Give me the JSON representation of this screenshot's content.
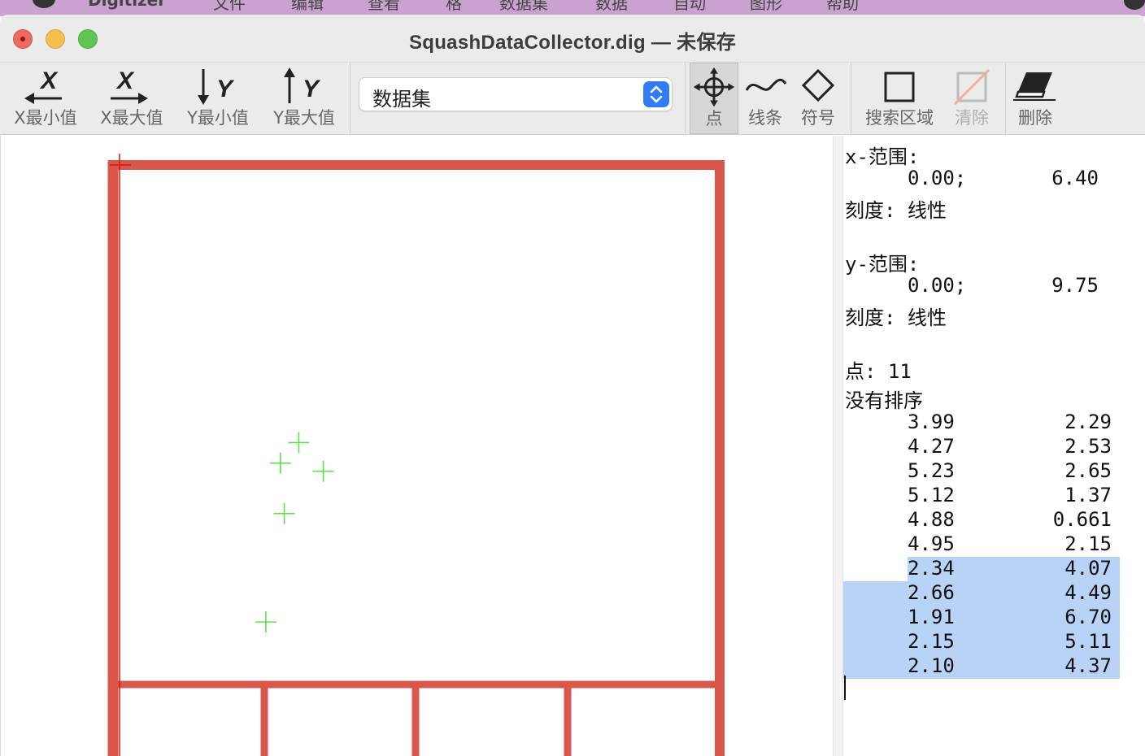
{
  "menubar": {
    "app_name": "Digitizer",
    "items": [
      "文件",
      "编辑",
      "查看",
      "格",
      "数据集",
      "数据",
      "自动",
      "图形",
      "帮助"
    ]
  },
  "window": {
    "title": "SquashDataCollector.dig — 未保存"
  },
  "toolbar": {
    "x_min": "X最小值",
    "x_max": "X最大值",
    "y_min": "Y最小值",
    "y_max": "Y最大值",
    "dataset_select": "数据集",
    "point": "点",
    "line": "线条",
    "symbol": "符号",
    "search_area": "搜索区域",
    "clear": "清除",
    "delete": "删除"
  },
  "panel": {
    "x_range_label": "x-范围:",
    "x_min": "0.00;",
    "x_max": "6.40",
    "x_scale": "刻度: 线性",
    "y_range_label": "y-范围:",
    "y_min": "0.00;",
    "y_max": "9.75",
    "y_scale": "刻度: 线性",
    "points_count": "点: 11",
    "sort_status": "没有排序",
    "rows": [
      {
        "x": "3.99",
        "y": "2.29",
        "selected": false
      },
      {
        "x": "4.27",
        "y": "2.53",
        "selected": false
      },
      {
        "x": "5.23",
        "y": "2.65",
        "selected": false
      },
      {
        "x": "5.12",
        "y": "1.37",
        "selected": false
      },
      {
        "x": "4.88",
        "y": "0.661",
        "selected": false
      },
      {
        "x": "4.95",
        "y": "2.15",
        "selected": false
      },
      {
        "x": "2.34",
        "y": "4.07",
        "selected": true
      },
      {
        "x": "2.66",
        "y": "4.49",
        "selected": true
      },
      {
        "x": "1.91",
        "y": "6.70",
        "selected": true
      },
      {
        "x": "2.15",
        "y": "5.11",
        "selected": true
      },
      {
        "x": "2.10",
        "y": "4.37",
        "selected": true
      }
    ]
  },
  "colors": {
    "court_line": "#d9574a",
    "marker": "#5ee04a",
    "origin_marker": "#e01010",
    "selection": "#b9d3f7",
    "stepper": "#2f7cf6"
  },
  "plot": {
    "markers": [
      {
        "x": 2.34,
        "y": 4.07
      },
      {
        "x": 2.66,
        "y": 4.49
      },
      {
        "x": 1.91,
        "y": 6.7
      },
      {
        "x": 2.15,
        "y": 5.11
      },
      {
        "x": 2.1,
        "y": 4.37
      }
    ]
  }
}
